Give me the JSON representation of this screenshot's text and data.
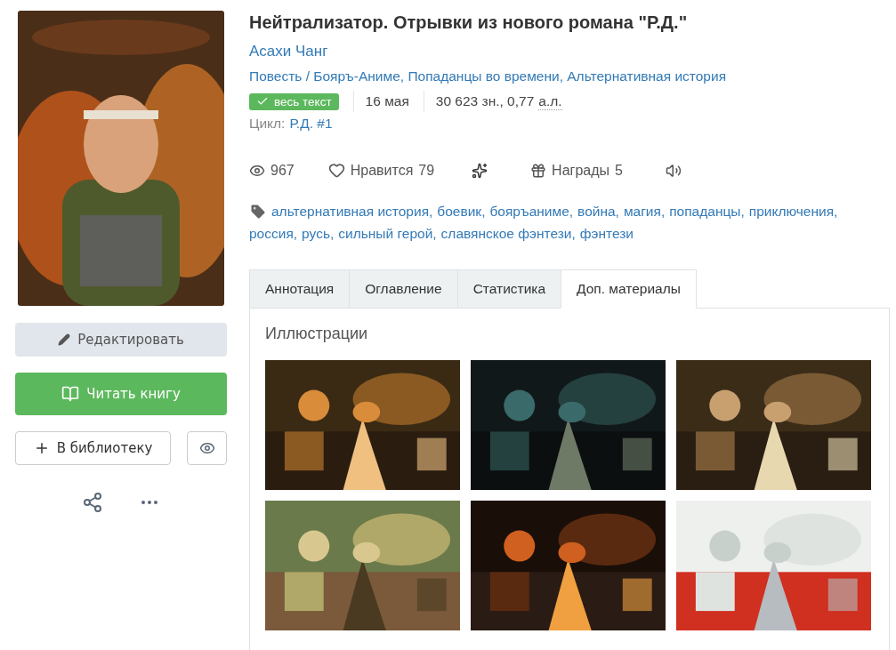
{
  "book": {
    "title": "Нейтрализатор. Отрывки из нового романа \"Р.Д.\"",
    "author": "Асахи Чанг",
    "genres": "Повесть / Бояръ-Аниме, Попаданцы во времени, Альтернативная история",
    "status": {
      "label": "весь текст",
      "complete": true
    },
    "date": "16 мая",
    "size": "30 623 зн., 0,77",
    "size_unit": "а.л.",
    "cycle": {
      "label": "Цикл:",
      "value": "Р.Д. #1"
    }
  },
  "stats": {
    "views": "967",
    "likes_label": "Нравится",
    "likes": "79",
    "awards_label": "Награды",
    "awards": "5"
  },
  "tags": [
    "альтернативная история,",
    "боевик,",
    "бояръаниме,",
    "война,",
    "магия,",
    "попаданцы,",
    "приключения,",
    "россия,",
    "русь,",
    "сильный герой,",
    "славянское фэнтези,",
    "фэнтези"
  ],
  "actions": {
    "edit": "Редактировать",
    "read": "Читать книгу",
    "library": "В библиотеку"
  },
  "tabs": [
    {
      "label": "Аннотация",
      "selected": false
    },
    {
      "label": "Оглавление",
      "selected": false
    },
    {
      "label": "Статистика",
      "selected": false
    },
    {
      "label": "Доп. материалы",
      "selected": true
    }
  ],
  "section": "Иллюстрации"
}
